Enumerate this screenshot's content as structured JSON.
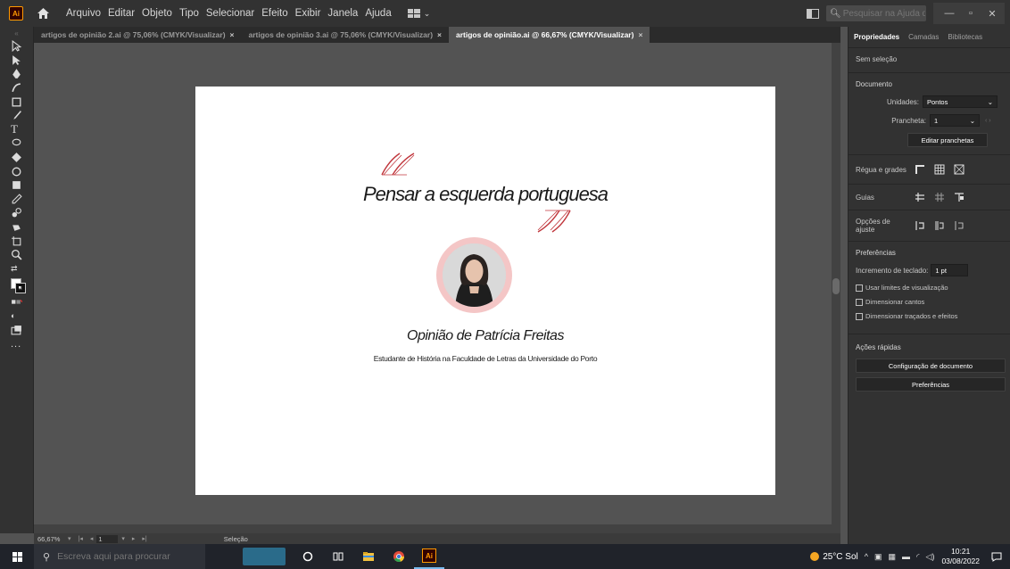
{
  "menubar": {
    "app_logo": "Ai",
    "items": [
      "Arquivo",
      "Editar",
      "Objeto",
      "Tipo",
      "Selecionar",
      "Efeito",
      "Exibir",
      "Janela",
      "Ajuda"
    ],
    "help_search_placeholder": "Pesquisar na Ajuda da Adobe",
    "icons": [
      "ai-logo",
      "home-icon",
      "workspace-switcher-icon",
      "arrange-documents-icon",
      "search-icon",
      "minimize-icon",
      "maximize-icon",
      "close-icon"
    ]
  },
  "tabs": [
    {
      "label": "artigos de opinião 2.ai @ 75,06% (CMYK/Visualizar)",
      "close": "×"
    },
    {
      "label": "artigos de opinião 3.ai @ 75,06% (CMYK/Visualizar)",
      "close": "×"
    },
    {
      "label": "artigos de opinião.ai @ 66,67% (CMYK/Visualizar)",
      "close": "×",
      "active": true
    }
  ],
  "toolbar": {
    "tools": [
      "selection-tool-icon",
      "direct-selection-tool-icon",
      "pen-tool-icon",
      "curvature-tool-icon",
      "rectangle-tool-icon",
      "paintbrush-tool-icon",
      "type-tool-icon",
      "lasso-tool-icon",
      "shaper-tool-icon",
      "rotate-tool-icon",
      "gradient-tool-icon",
      "eyedropper-tool-icon",
      "blend-tool-icon",
      "live-paint-tool-icon",
      "artboard-tool-icon",
      "zoom-tool-icon"
    ],
    "more": "..."
  },
  "artboard": {
    "title": "Pensar a esquerda portuguesa",
    "opinion": "Opinião de Patrícia Freitas",
    "subtitle": "Estudante de História na Faculdade de Letras da Universidade do Porto",
    "accent_color": "#c0353b",
    "ring_color": "#f4c6c6"
  },
  "statusbar": {
    "zoom": "66,67%",
    "page": "1",
    "mode": "Seleção"
  },
  "panel": {
    "tabs": [
      "Propriedades",
      "Camadas",
      "Bibliotecas"
    ],
    "no_selection": "Sem seleção",
    "document_title": "Documento",
    "units_label": "Unidades:",
    "units_value": "Pontos",
    "artboard_label": "Prancheta:",
    "artboard_value": "1",
    "edit_artboards": "Editar pranchetas",
    "rulers_label": "Régua e grades",
    "guides_label": "Guias",
    "snap_label": "Opções de ajuste",
    "prefs_title": "Preferências",
    "keyboard_increment_label": "Incremento de teclado:",
    "keyboard_increment_value": "1 pt",
    "checkboxes": [
      "Usar limites de visualização",
      "Dimensionar cantos",
      "Dimensionar traçados e efeitos"
    ],
    "quick_actions_title": "Ações rápidas",
    "quick_actions": [
      "Configuração de documento",
      "Preferências"
    ]
  },
  "taskbar": {
    "search_placeholder": "Escreva aqui para procurar",
    "weather": "25°C  Sol",
    "time": "10:21",
    "date": "03/08/2022",
    "apps": [
      "task-view-icon",
      "cortana-icon",
      "file-explorer-icon",
      "chrome-icon",
      "illustrator-icon"
    ]
  }
}
